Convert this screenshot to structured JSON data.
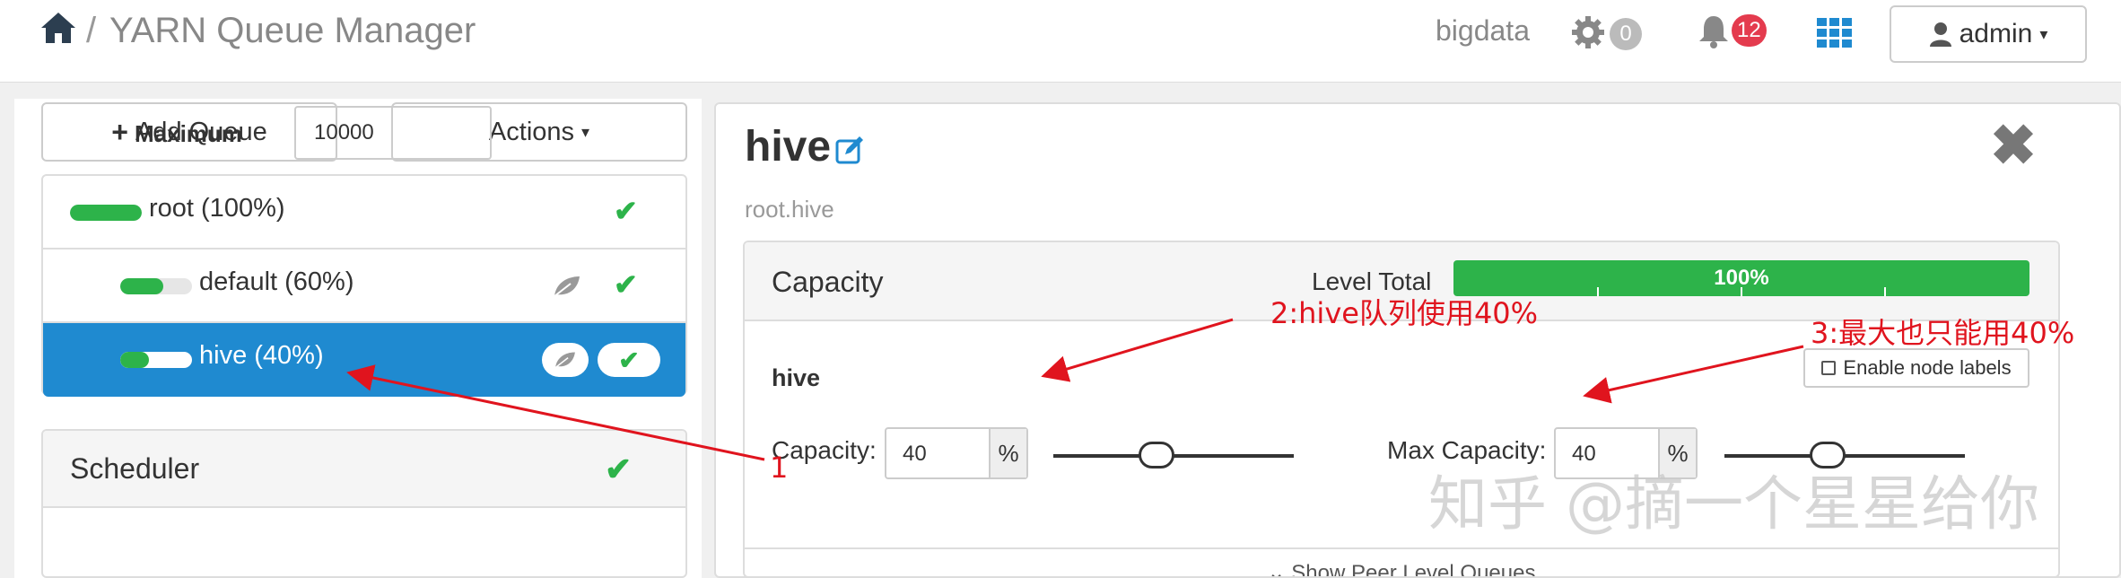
{
  "header": {
    "home_icon": "home-icon",
    "separator": "/",
    "title": "YARN Queue Manager",
    "cluster": "bigdata",
    "ops_count": "0",
    "alerts_count": "12",
    "user_label": "admin"
  },
  "left": {
    "add_queue_label": "Add Queue",
    "actions_label": "Actions",
    "queues": [
      {
        "label": "root (100%)",
        "fill": 1.0
      },
      {
        "label": "default (60%)",
        "fill": 0.6
      },
      {
        "label": "hive (40%)",
        "fill": 0.4
      }
    ],
    "scheduler": {
      "title": "Scheduler",
      "maximum_label": "Maximum",
      "maximum_value": "10000"
    }
  },
  "queue_detail": {
    "name": "hive",
    "path": "root.hive",
    "capacity_panel": {
      "title": "Capacity",
      "level_total_label": "Level Total",
      "level_total_value": "100%",
      "queue_name": "hive",
      "enable_node_labels": "Enable node labels",
      "capacity_label": "Capacity:",
      "capacity_value": "40",
      "capacity_unit": "%",
      "max_capacity_label": "Max Capacity:",
      "max_capacity_value": "40",
      "max_capacity_unit": "%",
      "capacity_fraction": 0.4,
      "max_capacity_fraction": 0.4,
      "show_peer_label": "Show Peer Level Queues"
    }
  },
  "annotations": {
    "a1": "1",
    "a2": "2:hive队列使用40%",
    "a3": "3:最大也只能用40%"
  },
  "watermark": "知乎 @摘一个星星给你",
  "colors": {
    "accent_blue": "#1f8ad0",
    "success_green": "#2db34a",
    "alert_red": "#e43b4e",
    "annotation_red": "#e0141e"
  }
}
